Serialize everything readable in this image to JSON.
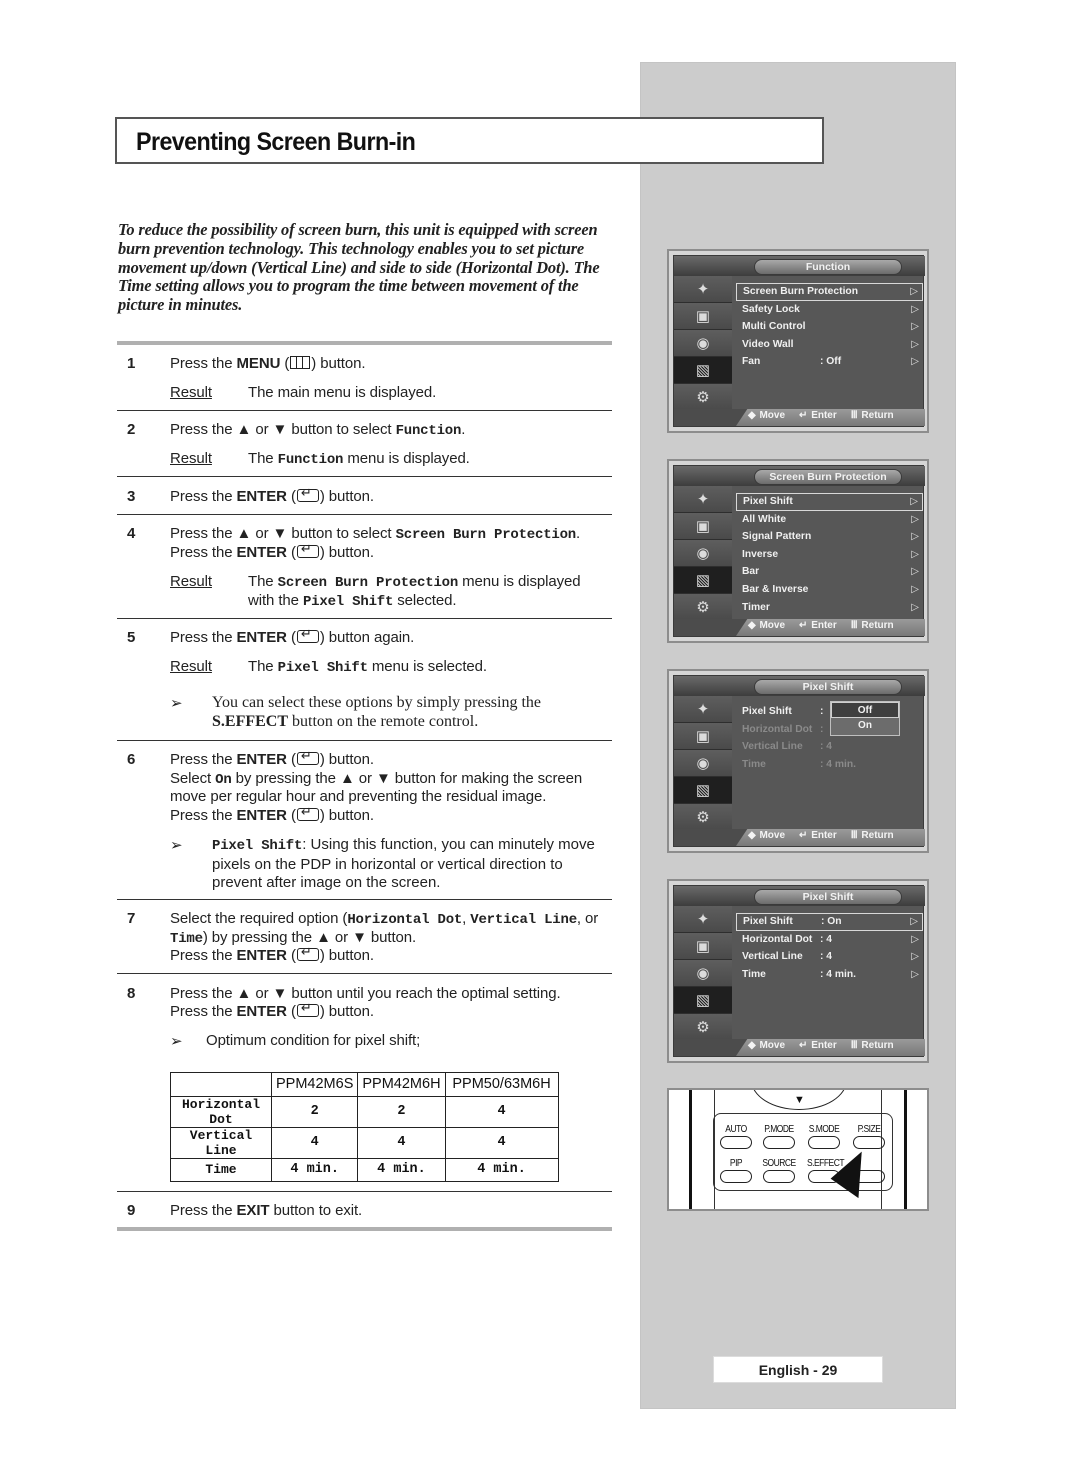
{
  "title": "Preventing Screen Burn-in",
  "intro": "To reduce the possibility of screen burn, this unit is equipped with screen burn prevention technology. This technology enables you to set picture movement up/down (Vertical Line) and side to side (Horizontal Dot). The Time setting allows you to program the time between movement of the picture in minutes.",
  "steps": {
    "s1": {
      "num": "1",
      "a": "Press the ",
      "b": "MENU",
      "c": " (",
      "d": ") button.",
      "result_label": "Result",
      "result_text": "The main menu is displayed."
    },
    "s2": {
      "num": "2",
      "a": "Press the ▲ or ▼ button to select ",
      "m": "Function",
      "c": ".",
      "result_label": "Result",
      "r1": "The ",
      "rm": "Function",
      "r2": " menu is displayed."
    },
    "s3": {
      "num": "3",
      "a": "Press the ",
      "b": "ENTER",
      "c": " (",
      "d": ") button."
    },
    "s4": {
      "num": "4",
      "a": "Press the ▲ or ▼ button to select ",
      "m": "Screen Burn Protection",
      "c": ".",
      "l2a": "Press the ",
      "l2b": "ENTER",
      "l2c": " (",
      "l2d": ") button.",
      "result_label": "Result",
      "r1": "The ",
      "rm": "Screen Burn Protection",
      "r2": " menu is displayed",
      "r3": "with the ",
      "rm2": "Pixel Shift",
      "r4": " selected."
    },
    "s5": {
      "num": "5",
      "a": "Press the ",
      "b": "ENTER",
      "c": " (",
      "d": ") button again.",
      "result_label": "Result",
      "r1": "The ",
      "rm": "Pixel Shift",
      "r2": " menu is selected.",
      "note_a": "You can select these options by simply pressing the",
      "note_b": "S.EFFECT",
      "note_c": " button on the remote control."
    },
    "s6": {
      "num": "6",
      "a": "Press the ",
      "b": "ENTER",
      "c": " (",
      "d": ") button.",
      "l2a": "Select ",
      "l2m": "On",
      "l2b": " by pressing the ▲ or ▼ button for making the screen",
      "l3": "move per regular hour and preventing the residual image.",
      "l4a": "Press the ",
      "l4b": "ENTER",
      "l4c": " (",
      "l4d": ") button.",
      "note_m": "Pixel Shift",
      "note_text": ": Using this function, you can minutely move pixels on the PDP in horizontal or vertical direction to prevent after image on the screen."
    },
    "s7": {
      "num": "7",
      "a": "Select the required option (",
      "m1": "Horizontal Dot",
      "sep1": ", ",
      "m2": "Vertical Line",
      "sep2": ", or",
      "m3": "Time",
      "l2": ") by pressing the ▲ or ▼ button.",
      "l3a": "Press the ",
      "l3b": "ENTER",
      "l3c": " (",
      "l3d": ") button."
    },
    "s8": {
      "num": "8",
      "a": "Press the ▲ or ▼ button until you reach the optimal setting.",
      "l2a": "Press the ",
      "l2b": "ENTER",
      "l2c": " (",
      "l2d": ") button.",
      "note": "Optimum condition for pixel shift;"
    },
    "s9": {
      "num": "9",
      "a": "Press the ",
      "b": "EXIT",
      "c": " button to exit."
    }
  },
  "note_arrow": "➢",
  "table": {
    "headers": [
      "",
      "PPM42M6S",
      "PPM42M6H",
      "PPM50/63M6H"
    ],
    "rows": [
      {
        "label": "Horizontal Dot",
        "values": [
          "2",
          "2",
          "4"
        ]
      },
      {
        "label": "Vertical Line",
        "values": [
          "4",
          "4",
          "4"
        ]
      },
      {
        "label": "Time",
        "values": [
          "4 min.",
          "4 min.",
          "4 min."
        ]
      }
    ]
  },
  "tv_footer": {
    "move": "◆ Move",
    "enter": "↵ Enter",
    "return": "Ⅲ Return"
  },
  "tv_sidebar_icons": [
    "antenna-icon",
    "picture-icon",
    "sound-icon",
    "function-icon",
    "setup-icon"
  ],
  "screens": [
    {
      "title": "Function",
      "items": [
        {
          "label": "Screen Burn Protection",
          "value": "",
          "arrow": true,
          "selected": true
        },
        {
          "label": "Safety Lock",
          "value": "",
          "arrow": true
        },
        {
          "label": "Multi Control",
          "value": "",
          "arrow": true
        },
        {
          "label": "Video Wall",
          "value": "",
          "arrow": true
        },
        {
          "label": "Fan",
          "value": ": Off",
          "arrow": true
        }
      ]
    },
    {
      "title": "Screen Burn Protection",
      "items": [
        {
          "label": "Pixel Shift",
          "value": "",
          "arrow": true,
          "selected": true
        },
        {
          "label": "All White",
          "value": "",
          "arrow": true
        },
        {
          "label": "Signal Pattern",
          "value": "",
          "arrow": true
        },
        {
          "label": "Inverse",
          "value": "",
          "arrow": true
        },
        {
          "label": "Bar",
          "value": "",
          "arrow": true
        },
        {
          "label": "Bar & Inverse",
          "value": "",
          "arrow": true
        },
        {
          "label": "Timer",
          "value": "",
          "arrow": true
        }
      ]
    },
    {
      "title": "Pixel Shift",
      "items": [
        {
          "label": "Pixel Shift",
          "value": ":",
          "arrow": false
        },
        {
          "label": "Horizontal Dot",
          "value": ":",
          "arrow": false,
          "dim": true
        },
        {
          "label": "Vertical Line",
          "value": ": 4",
          "arrow": false,
          "dim": true
        },
        {
          "label": "Time",
          "value": ": 4 min.",
          "arrow": false,
          "dim": true
        }
      ],
      "popup": {
        "options": [
          "Off",
          "On"
        ],
        "selected": "Off"
      }
    },
    {
      "title": "Pixel Shift",
      "items": [
        {
          "label": "Pixel Shift",
          "value": ": On",
          "arrow": true,
          "selected": true
        },
        {
          "label": "Horizontal Dot",
          "value": ": 4",
          "arrow": true
        },
        {
          "label": "Vertical Line",
          "value": ": 4",
          "arrow": true
        },
        {
          "label": "Time",
          "value": ": 4 min.",
          "arrow": true
        }
      ]
    }
  ],
  "remote": {
    "row1": [
      "AUTO",
      "P.MODE",
      "S.MODE",
      "P.SIZE"
    ],
    "row2": [
      "PIP",
      "SOURCE",
      "S.EFFECT",
      ""
    ]
  },
  "footer": {
    "page_label": "English - 29"
  }
}
